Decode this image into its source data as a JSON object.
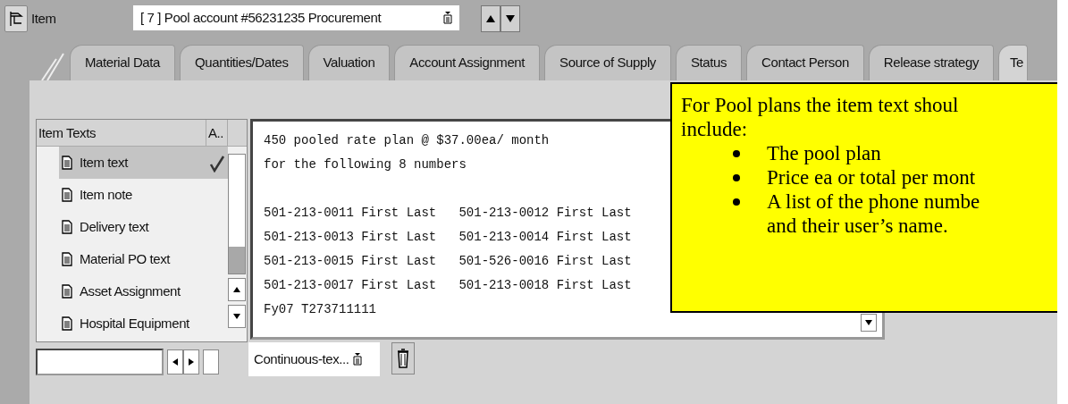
{
  "item_bar": {
    "label": "Item",
    "selector": "[ 7 ] Pool account #56231235 Procurement"
  },
  "tabs": [
    {
      "label": "Material Data",
      "selected": false
    },
    {
      "label": "Quantities/Dates",
      "selected": false
    },
    {
      "label": "Valuation",
      "selected": false
    },
    {
      "label": "Account Assignment",
      "selected": false
    },
    {
      "label": "Source of Supply",
      "selected": false
    },
    {
      "label": "Status",
      "selected": false
    },
    {
      "label": "Contact Person",
      "selected": false
    },
    {
      "label": "Release strategy",
      "selected": false
    },
    {
      "label": "Te",
      "selected": true
    }
  ],
  "text_types": {
    "columns": [
      "Item Texts",
      "A.."
    ],
    "rows": [
      {
        "label": "Item text",
        "selected": true,
        "checked": true
      },
      {
        "label": "Item note",
        "selected": false,
        "checked": false
      },
      {
        "label": "Delivery text",
        "selected": false,
        "checked": false
      },
      {
        "label": "Material PO text",
        "selected": false,
        "checked": false
      },
      {
        "label": "Asset Assignment",
        "selected": false,
        "checked": false
      },
      {
        "label": "Hospital Equipment",
        "selected": false,
        "checked": false
      }
    ]
  },
  "editor": {
    "paragraphs": [
      [
        "450 pooled rate plan @ $37.00ea/ month",
        "for the following 8 numbers"
      ],
      [
        "501-213-0011 First Last   501-213-0012 First Last",
        "501-213-0013 First Last   501-213-0014 First Last",
        "501-213-0015 First Last   501-526-0016 First Last",
        "501-213-0017 First Last   501-213-0018 First Last",
        "Fy07 T273711111"
      ]
    ]
  },
  "format": {
    "value": "Continuous-tex..."
  },
  "callout": {
    "intro": [
      "For Pool plans the item text shoul",
      "include:"
    ],
    "bullets": [
      [
        "The pool plan"
      ],
      [
        "Price ea or total per mont"
      ],
      [
        "A list of the phone numbe",
        "and their user’s name."
      ]
    ]
  }
}
